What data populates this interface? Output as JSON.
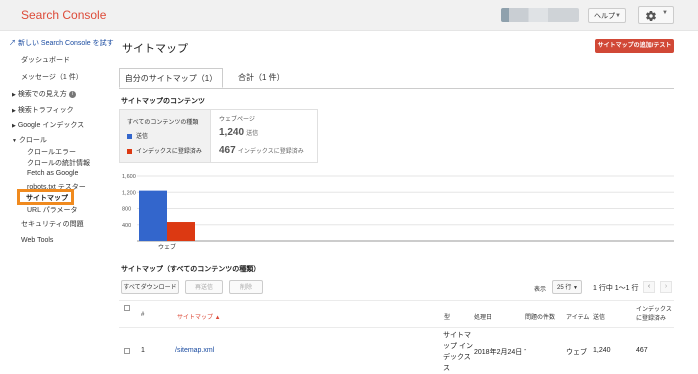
{
  "header": {
    "logo": "Search Console",
    "help_label": "ヘルプ"
  },
  "sidebar": {
    "new_console_link": "新しい Search Console を試す",
    "items": {
      "dashboard": "ダッシュボード",
      "messages": "メッセージ（1 件）",
      "search_appearance": "検索での見え方",
      "search_traffic": "検索トラフィック",
      "google_index": "Google インデックス",
      "crawl": "クロール",
      "crawl_errors": "クロールエラー",
      "crawl_stats": "クロールの統計情報",
      "fetch_as_google": "Fetch as Google",
      "robots_tester": "robots.txt テスター",
      "sitemaps": "サイトマップ",
      "url_params": "URL パラメータ",
      "security": "セキュリティの問題",
      "web_tools": "Web Tools"
    }
  },
  "main": {
    "title": "サイトマップ",
    "test_button": "サイトマップの追加/テスト",
    "tabs": [
      "自分のサイトマップ（1）",
      "合計（1 件）"
    ],
    "contents_heading": "サイトマップのコンテンツ",
    "legend_header": "すべてのコンテンツの種類",
    "legend_submitted": "送信",
    "legend_indexed": "インデックスに登録済み",
    "webpage_header": "ウェブページ",
    "submitted_count": "1,240",
    "submitted_label": "送信",
    "indexed_count": "467",
    "indexed_label": "インデックスに登録済み"
  },
  "chart_data": {
    "type": "bar",
    "categories": [
      "ウェブ"
    ],
    "series": [
      {
        "name": "送信",
        "values": [
          1240
        ],
        "color": "#3366cc"
      },
      {
        "name": "インデックスに登録済み",
        "values": [
          467
        ],
        "color": "#dc3912"
      }
    ],
    "ylim": [
      0,
      1600
    ],
    "yticks": [
      "1,600",
      "1,200",
      "800",
      "400"
    ],
    "grid": true
  },
  "table": {
    "heading": "サイトマップ（すべてのコンテンツの種類）",
    "download_button": "すべてダウンロード",
    "resubmit_button": "再送信",
    "delete_button": "削除",
    "show_label": "表示",
    "rows_select": "25 行",
    "pagination": "1 行中 1〜1 行",
    "columns": {
      "num": "#",
      "sitemap": "サイトマップ ▲",
      "type": "型",
      "processed": "処理日",
      "issues": "問題の件数",
      "items": "アイテム",
      "submitted": "送信",
      "indexed_1": "インデックス",
      "indexed_2": "に登録済み"
    },
    "row": {
      "num": "1",
      "sitemap": "/sitemap.xml",
      "type_lines": [
        "サイトマ",
        "ップ イン",
        "デックス"
      ],
      "processed": "2018年2月24日",
      "issues": "-",
      "items": "ウェブ",
      "submitted": "1,240",
      "indexed": "467"
    }
  }
}
